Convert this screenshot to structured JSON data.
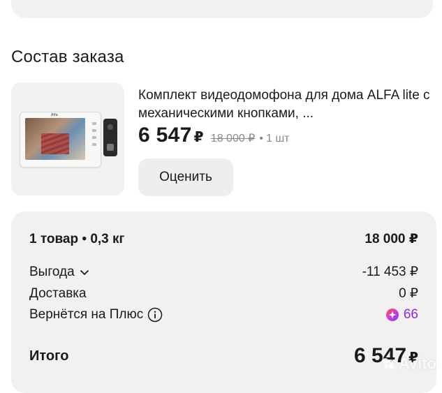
{
  "order": {
    "section_title": "Состав заказа",
    "product": {
      "name": "Комплект видеодомофона для дома ALFA lite с механическими кнопками, ...",
      "price": "6 547",
      "currency": "₽",
      "old_price": "18 000 ₽",
      "separator": "•",
      "quantity": "1 шт",
      "rate_label": "Оценить",
      "image_brand": "Alfa"
    }
  },
  "summary": {
    "items_label": "1 товар • 0,3 кг",
    "items_value": "18 000 ₽",
    "benefit_label": "Выгода",
    "benefit_value": "-11 453 ₽",
    "delivery_label": "Доставка",
    "delivery_value": "0 ₽",
    "cashback_label": "Вернётся на Плюс",
    "cashback_value": "66",
    "total_label": "Итого",
    "total_value": "6 547",
    "total_currency": "₽"
  },
  "watermark": "Avito",
  "colors": {
    "accent_plus": "#8a2be2",
    "card_bg": "#f2f1f0",
    "muted_text": "#8a8a8a"
  }
}
